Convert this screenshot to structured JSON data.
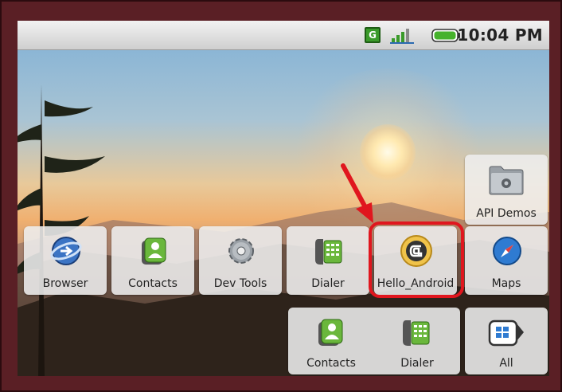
{
  "status_bar": {
    "network_badge": "G",
    "time": "10:04 PM",
    "icons": [
      "network-type-icon",
      "signal-strength-icon",
      "battery-icon"
    ]
  },
  "home": {
    "apps_row1": [
      {
        "label": "Browser",
        "icon": "browser-icon"
      },
      {
        "label": "Contacts",
        "icon": "contacts-icon"
      },
      {
        "label": "Dev Tools",
        "icon": "dev-tools-icon"
      },
      {
        "label": "Dialer",
        "icon": "dialer-icon"
      },
      {
        "label": "Hello_Android",
        "icon": "hello-android-icon"
      },
      {
        "label": "Maps",
        "icon": "maps-icon"
      }
    ],
    "apps_top": [
      {
        "label": "API Demos",
        "icon": "folder-gear-icon"
      }
    ],
    "dock": [
      {
        "label": "Contacts",
        "icon": "contacts-icon"
      },
      {
        "label": "Dialer",
        "icon": "dialer-icon"
      },
      {
        "label": "All",
        "icon": "all-apps-icon"
      }
    ]
  },
  "annotation": {
    "highlight_color": "#e0161e",
    "highlighted_app": "Hello_Android"
  },
  "colors": {
    "frame": "#5a1f25",
    "status_bar": "#d9d9d9",
    "tile": "#eeeeee",
    "badge_green": "#3a9a2a"
  }
}
